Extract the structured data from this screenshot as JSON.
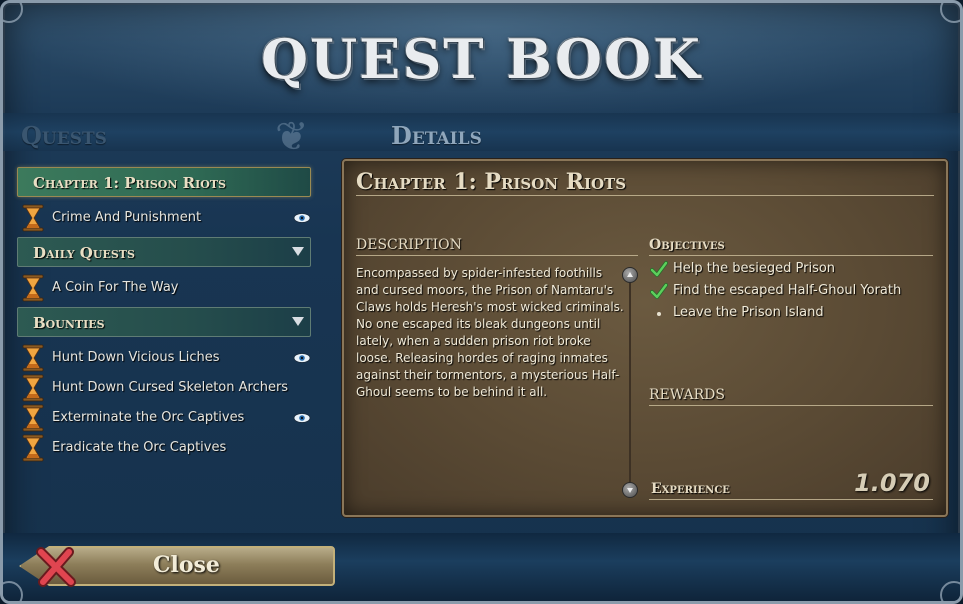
{
  "window": {
    "title": "Quest Book",
    "title_display": "QUEST BOOK"
  },
  "sections": {
    "quests_label": "Quests",
    "details_label": "Details"
  },
  "quest_list": {
    "categories": [
      {
        "label": "Chapter 1: Prison Riots",
        "state": "selected",
        "items": [
          {
            "label": "Crime And Punishment",
            "tracked": true
          }
        ]
      },
      {
        "label": "Daily Quests",
        "state": "expanded",
        "items": [
          {
            "label": "A Coin For The Way",
            "tracked": false
          }
        ]
      },
      {
        "label": "Bounties",
        "state": "expanded",
        "items": [
          {
            "label": "Hunt Down Vicious Liches",
            "tracked": true
          },
          {
            "label": "Hunt Down Cursed Skeleton Archers",
            "tracked": false
          },
          {
            "label": "Exterminate the Orc Captives",
            "tracked": true
          },
          {
            "label": "Eradicate the Orc Captives",
            "tracked": false
          }
        ]
      }
    ]
  },
  "details": {
    "title": "Chapter 1: Prison Riots",
    "description_heading": "DESCRIPTION",
    "description": "Encompassed by spider-infested foothills and cursed moors, the Prison of Namtaru's Claws holds Heresh's most wicked criminals. No one escaped its bleak dungeons until lately, when a sudden prison riot broke loose. Releasing hordes of raging inmates against their tormentors, a mysterious Half-Ghoul seems to be behind it all.",
    "objectives_heading": "Objectives",
    "objectives": [
      {
        "text": "Help the besieged Prison",
        "status": "complete"
      },
      {
        "text": "Find the escaped Half-Ghoul Yorath",
        "status": "complete"
      },
      {
        "text": "Leave the Prison Island",
        "status": "pending"
      }
    ],
    "rewards_heading": "REWARDS",
    "experience_label": "Experience",
    "experience_value": "1.070"
  },
  "footer": {
    "close_label": "Close"
  },
  "colors": {
    "frame_blue": "#1d3b58",
    "parchment": "#5a4a34",
    "selected_header": "#3c7a5c",
    "check_green": "#4fbf4f",
    "close_x_red": "#d0404a"
  }
}
